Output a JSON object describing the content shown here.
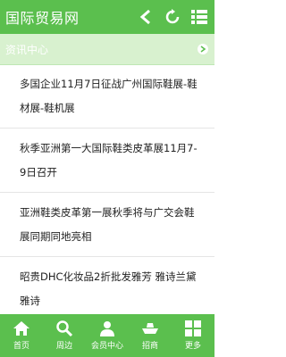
{
  "header": {
    "title": "国际贸易网",
    "back_icon": "back-icon",
    "refresh_icon": "refresh-icon",
    "menu_icon": "grid-menu-icon"
  },
  "section": {
    "label": "资讯中心",
    "more_icon": "chevron-right-icon"
  },
  "news": [
    {
      "title": "多国企业11月7日征战广州国际鞋展-鞋材展-鞋机展"
    },
    {
      "title": "秋季亚洲第一大国际鞋类皮革展11月7-9日召开"
    },
    {
      "title": "亚洲鞋类皮革第一展秋季将与广交会鞋展同期同地亮相"
    },
    {
      "title": "昭贵DHC化妆品2折批发雅芳 雅诗兰黛 雅诗"
    }
  ],
  "nav": [
    {
      "label": "首页",
      "icon": "home-icon"
    },
    {
      "label": "周边",
      "icon": "search-icon"
    },
    {
      "label": "会员中心",
      "icon": "user-icon"
    },
    {
      "label": "招商",
      "icon": "ship-icon"
    },
    {
      "label": "更多",
      "icon": "grid-icon"
    }
  ],
  "colors": {
    "primary": "#5bbf4e",
    "section_bg": "#d8f1cf"
  }
}
